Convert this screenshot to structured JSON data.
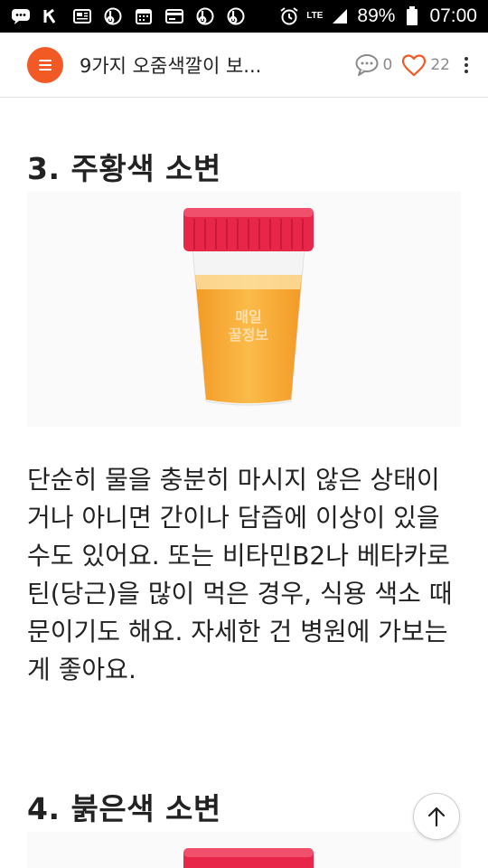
{
  "status_bar": {
    "battery": "89%",
    "time": "07:00",
    "network": "LTE",
    "icons": [
      "message-icon",
      "k-icon",
      "news-icon",
      "b-app-icon",
      "calendar-icon",
      "card-icon",
      "b-app-icon",
      "b-app-icon",
      "alarm-icon",
      "signal-icon",
      "battery-icon"
    ]
  },
  "header": {
    "title": "9가지 오줌색깔이 보...",
    "comment_count": "0",
    "like_count": "22",
    "accent_color": "#f15a24"
  },
  "article": {
    "heading_3": "3. 주황색 소변",
    "image_1_watermark": "매일 꿀정보",
    "paragraph": "단순히 물을 충분히 마시지 않은 상태이거나 아니면 간이나 담즙에 이상이 있을 수도 있어요. 또는 비타민B2나 베타카로틴(당근)을 많이 먹은 경우, 식용 색소 때문이기도 해요. 자세한 건 병원에 가보는 게 좋아요.",
    "heading_4": "4. 붉은색 소변"
  },
  "colors": {
    "cap_red": "#e8264a",
    "urine_orange": "#f7a531"
  }
}
